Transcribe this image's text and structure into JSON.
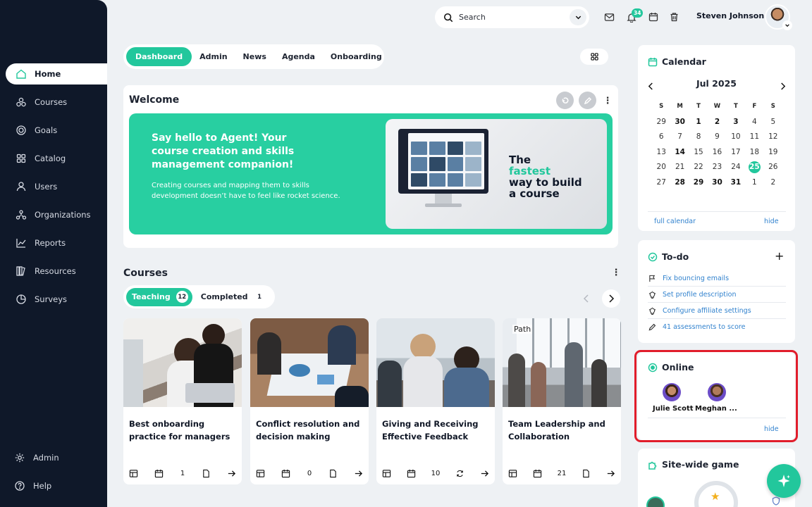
{
  "sidebar": {
    "items": [
      {
        "label": "Home",
        "icon": "home-icon"
      },
      {
        "label": "Courses",
        "icon": "courses-icon"
      },
      {
        "label": "Goals",
        "icon": "goals-icon"
      },
      {
        "label": "Catalog",
        "icon": "catalog-icon"
      },
      {
        "label": "Users",
        "icon": "user-icon"
      },
      {
        "label": "Organizations",
        "icon": "organizations-icon"
      },
      {
        "label": "Reports",
        "icon": "reports-icon"
      },
      {
        "label": "Resources",
        "icon": "resources-icon"
      },
      {
        "label": "Surveys",
        "icon": "surveys-icon"
      }
    ],
    "bottom": [
      {
        "label": "Admin",
        "icon": "gear-icon"
      },
      {
        "label": "Help",
        "icon": "help-icon"
      }
    ]
  },
  "topbar": {
    "search_placeholder": "Search",
    "notification_count": "34",
    "username": "Steven Johnson"
  },
  "tabs": [
    "Dashboard",
    "Admin",
    "News",
    "Agenda",
    "Onboarding"
  ],
  "welcome": {
    "title": "Welcome",
    "headline": "Say hello to Agent! Your course creation and skills management companion!",
    "subtext": "Creating courses and mapping them to skills development doesn’t have to feel like rocket science.",
    "promo_line1": "The",
    "promo_line2": "fastest",
    "promo_line3": "way to build",
    "promo_line4": "a course"
  },
  "courses": {
    "title": "Courses",
    "tabs": [
      {
        "label": "Teaching",
        "count": "12"
      },
      {
        "label": "Completed",
        "count": "1"
      }
    ],
    "cards": [
      {
        "title": "Best onboarding practice for managers",
        "count": "1",
        "tag": ""
      },
      {
        "title": "Conflict resolution and decision making",
        "count": "0",
        "tag": ""
      },
      {
        "title": "Giving and Receiving Effective Feedback",
        "count": "10",
        "tag": ""
      },
      {
        "title": "Team Leadership and Collaboration",
        "count": "21",
        "tag": "Path"
      }
    ]
  },
  "calendar": {
    "title": "Calendar",
    "month": "Jul 2025",
    "weekdays": [
      "S",
      "M",
      "T",
      "W",
      "T",
      "F",
      "S"
    ],
    "days": [
      "29",
      "30",
      "1",
      "2",
      "3",
      "4",
      "5",
      "6",
      "7",
      "8",
      "9",
      "10",
      "11",
      "12",
      "13",
      "14",
      "15",
      "16",
      "17",
      "18",
      "19",
      "20",
      "21",
      "22",
      "23",
      "24",
      "25",
      "26",
      "27",
      "28",
      "29",
      "30",
      "31",
      "1",
      "2"
    ],
    "full_calendar": "full calendar",
    "hide": "hide"
  },
  "todo": {
    "title": "To-do",
    "items": [
      {
        "label": "Fix bouncing emails",
        "icon": "flag-icon"
      },
      {
        "label": "Set profile description",
        "icon": "lightbulb-icon"
      },
      {
        "label": "Configure affiliate settings",
        "icon": "lightbulb-icon"
      },
      {
        "label": "41 assessments to score",
        "icon": "pencil-icon"
      }
    ]
  },
  "online": {
    "title": "Online",
    "users": [
      "Julie Scott",
      "Meghan ..."
    ],
    "hide": "hide"
  },
  "game": {
    "title": "Site-wide game"
  },
  "colors": {
    "accent": "#22c79c",
    "sidebar": "#0f1829",
    "link": "#3182ce",
    "highlight_border": "#e11d2b"
  }
}
